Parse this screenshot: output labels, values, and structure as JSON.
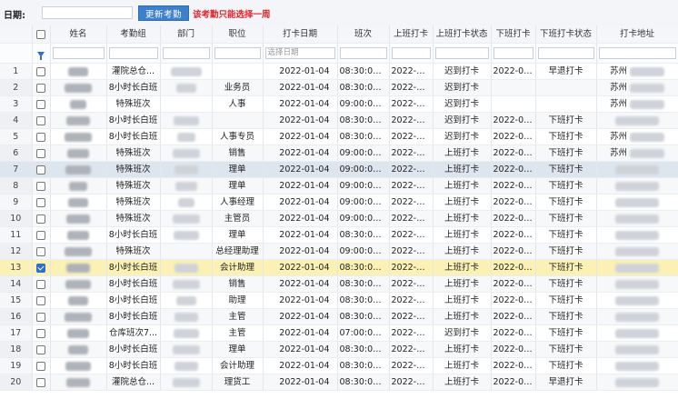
{
  "toolbar": {
    "date_label": "日期:",
    "date_value": "",
    "refresh_label": "更新考勤",
    "notice": "该考勤只能选择一周"
  },
  "columns": [
    "",
    "",
    "姓名",
    "考勤组",
    "部门",
    "职位",
    "打卡日期",
    "班次",
    "上班打卡",
    "上班打卡状态",
    "下班打卡",
    "下班打卡状态",
    "打卡地址"
  ],
  "filter_placeholder_date": "选择日期",
  "rows": [
    {
      "n": "1",
      "group": "灌院总仓...",
      "pos": "",
      "date": "2022-01-04",
      "shift": "08:30:00~...",
      "in": "2022-01...",
      "in_status": "迟到打卡",
      "out": "2022-01...",
      "out_status": "早退打卡",
      "addr": "苏州",
      "checked": false
    },
    {
      "n": "2",
      "group": "8小时长白班",
      "pos": "业务员",
      "date": "2022-01-04",
      "shift": "08:30:00~...",
      "in": "2022-01...",
      "in_status": "迟到打卡",
      "out": "",
      "out_status": "",
      "addr": "苏州",
      "checked": false
    },
    {
      "n": "3",
      "group": "特殊班次",
      "pos": "人事",
      "date": "2022-01-04",
      "shift": "09:00:00~...",
      "in": "2022-01...",
      "in_status": "迟到打卡",
      "out": "",
      "out_status": "",
      "addr": "苏州",
      "checked": false
    },
    {
      "n": "4",
      "group": "8小时长白班",
      "pos": "",
      "date": "2022-01-04",
      "shift": "08:30:00~...",
      "in": "2022-01...",
      "in_status": "迟到打卡",
      "out": "2022-01...",
      "out_status": "下班打卡",
      "addr": "",
      "checked": false
    },
    {
      "n": "5",
      "group": "8小时长白班",
      "pos": "人事专员",
      "date": "2022-01-04",
      "shift": "08:30:00~...",
      "in": "2022-01...",
      "in_status": "迟到打卡",
      "out": "2022-01...",
      "out_status": "下班打卡",
      "addr": "苏州",
      "checked": false
    },
    {
      "n": "6",
      "group": "特殊班次",
      "pos": "销售",
      "date": "2022-01-04",
      "shift": "09:00:00~...",
      "in": "2022-01...",
      "in_status": "上班打卡",
      "out": "2022-01...",
      "out_status": "下班打卡",
      "addr": "苏州",
      "checked": false
    },
    {
      "n": "7",
      "group": "特殊班次",
      "pos": "理单",
      "date": "2022-01-04",
      "shift": "09:00:00~...",
      "in": "2022-01...",
      "in_status": "上班打卡",
      "out": "2022-01...",
      "out_status": "下班打卡",
      "addr": "",
      "checked": false
    },
    {
      "n": "8",
      "group": "特殊班次",
      "pos": "理单",
      "date": "2022-01-04",
      "shift": "09:00:00~...",
      "in": "2022-01...",
      "in_status": "上班打卡",
      "out": "2022-01...",
      "out_status": "下班打卡",
      "addr": "",
      "checked": false
    },
    {
      "n": "9",
      "group": "特殊班次",
      "pos": "人事经理",
      "date": "2022-01-04",
      "shift": "09:00:00~...",
      "in": "2022-01...",
      "in_status": "上班打卡",
      "out": "2022-01...",
      "out_status": "下班打卡",
      "addr": "",
      "checked": false
    },
    {
      "n": "10",
      "group": "特殊班次",
      "pos": "主管员",
      "date": "2022-01-04",
      "shift": "09:00:00~...",
      "in": "2022-01...",
      "in_status": "上班打卡",
      "out": "2022-01...",
      "out_status": "下班打卡",
      "addr": "",
      "checked": false
    },
    {
      "n": "11",
      "group": "8小时长白班",
      "pos": "理单",
      "date": "2022-01-04",
      "shift": "08:30:00~...",
      "in": "2022-01...",
      "in_status": "上班打卡",
      "out": "2022-01...",
      "out_status": "下班打卡",
      "addr": "",
      "checked": false
    },
    {
      "n": "12",
      "group": "特殊班次",
      "pos": "总经理助理",
      "date": "2022-01-04",
      "shift": "09:00:00~...",
      "in": "2022-01...",
      "in_status": "上班打卡",
      "out": "2022-01...",
      "out_status": "下班打卡",
      "addr": "",
      "checked": false
    },
    {
      "n": "13",
      "group": "8小时长白班",
      "pos": "会计助理",
      "date": "2022-01-04",
      "shift": "08:30:00~...",
      "in": "2022-01...",
      "in_status": "上班打卡",
      "out": "2022-01...",
      "out_status": "下班打卡",
      "addr": "",
      "checked": true
    },
    {
      "n": "14",
      "group": "8小时长白班",
      "pos": "销售",
      "date": "2022-01-04",
      "shift": "08:30:00~...",
      "in": "2022-01...",
      "in_status": "上班打卡",
      "out": "2022-01...",
      "out_status": "下班打卡",
      "addr": "",
      "checked": false
    },
    {
      "n": "15",
      "group": "8小时长白班",
      "pos": "助理",
      "date": "2022-01-04",
      "shift": "08:30:00~...",
      "in": "2022-01...",
      "in_status": "上班打卡",
      "out": "2022-01...",
      "out_status": "下班打卡",
      "addr": "",
      "checked": false
    },
    {
      "n": "16",
      "group": "8小时长白班",
      "pos": "主管",
      "date": "2022-01-04",
      "shift": "08:30:00~...",
      "in": "2022-01...",
      "in_status": "上班打卡",
      "out": "2022-01...",
      "out_status": "下班打卡",
      "addr": "",
      "checked": false
    },
    {
      "n": "17",
      "group": "仓库班次7...",
      "pos": "主管",
      "date": "2022-01-04",
      "shift": "07:00:00~...",
      "in": "2022-01...",
      "in_status": "迟到打卡",
      "out": "2022-01...",
      "out_status": "下班打卡",
      "addr": "",
      "checked": false
    },
    {
      "n": "18",
      "group": "8小时长白班",
      "pos": "理单",
      "date": "2022-01-04",
      "shift": "08:30:00~...",
      "in": "2022-01...",
      "in_status": "上班打卡",
      "out": "2022-01...",
      "out_status": "下班打卡",
      "addr": "",
      "checked": false
    },
    {
      "n": "19",
      "group": "8小时长白班",
      "pos": "会计助理",
      "date": "2022-01-04",
      "shift": "08:30:00~...",
      "in": "2022-01...",
      "in_status": "上班打卡",
      "out": "2022-01...",
      "out_status": "下班打卡",
      "addr": "",
      "checked": false
    },
    {
      "n": "20",
      "group": "灌院总仓...",
      "pos": "理货工",
      "date": "2022-01-04",
      "shift": "08:30:00~...",
      "in": "2022-01...",
      "in_status": "上班打卡",
      "out": "2022-01...",
      "out_status": "早退打卡",
      "addr": "",
      "checked": false
    }
  ],
  "row_highlights": {
    "hover_row": "7",
    "selected_row": "13"
  },
  "icons": {
    "filter": "filter-funnel-icon"
  },
  "colors": {
    "accent": "#3d80cc",
    "notice": "#e0262c",
    "selected_row": "#fbf1b4",
    "hover_row": "#dde5ef"
  }
}
